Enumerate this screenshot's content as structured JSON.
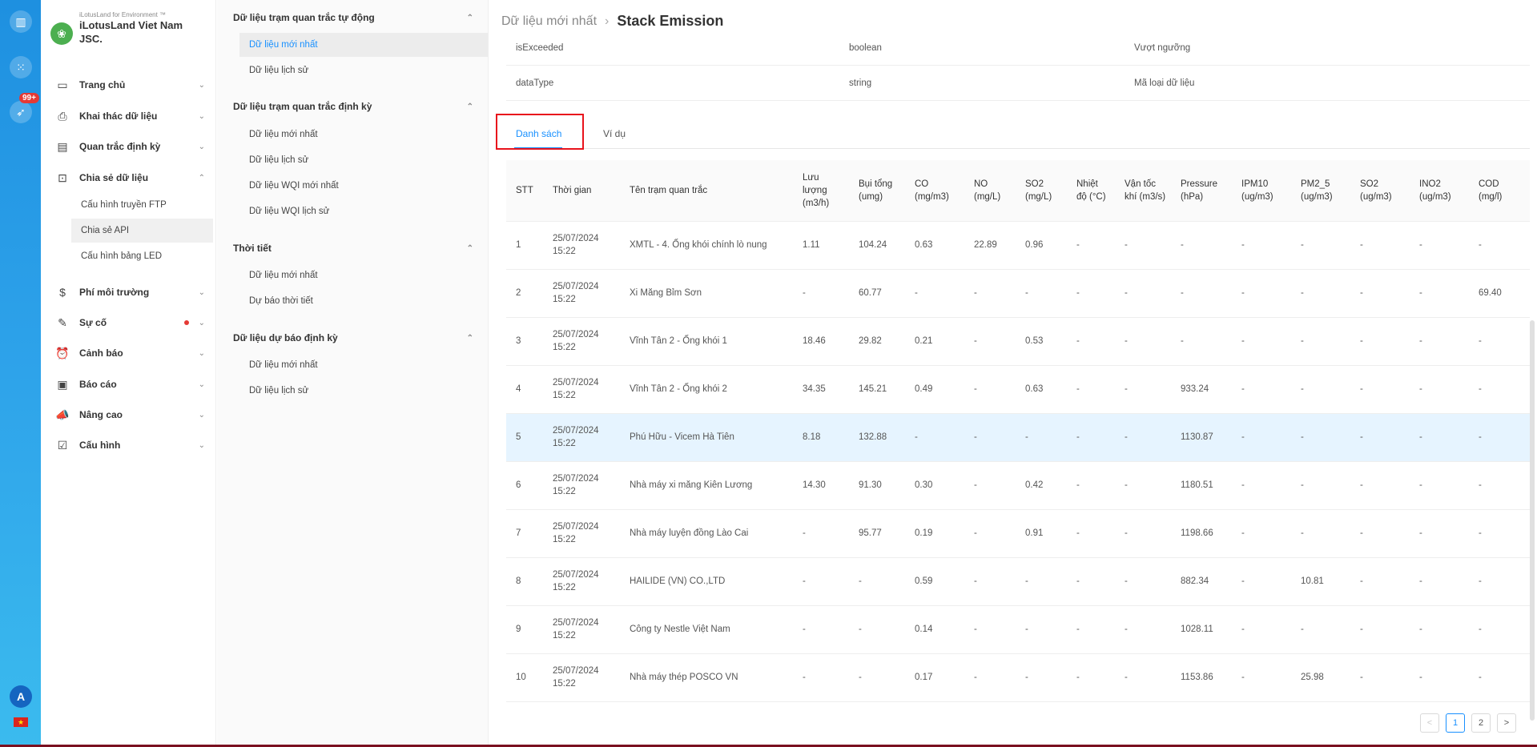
{
  "brand": {
    "sub": "iLotusLand for Environment ™",
    "name": "iLotusLand Viet Nam JSC."
  },
  "rail": {
    "badge": "99+",
    "avatar": "A",
    "flag": "★"
  },
  "nav": [
    {
      "label": "Trang chủ",
      "icon": "▭"
    },
    {
      "label": "Khai thác dữ liệu",
      "icon": "⎙"
    },
    {
      "label": "Quan trắc định kỳ",
      "icon": "▤"
    },
    {
      "label": "Chia sẻ dữ liệu",
      "icon": "⊡"
    },
    {
      "label": "Phí môi trường",
      "icon": "$"
    },
    {
      "label": "Sự cố",
      "icon": "✎"
    },
    {
      "label": "Cảnh báo",
      "icon": "⏰"
    },
    {
      "label": "Báo cáo",
      "icon": "▣"
    },
    {
      "label": "Nâng cao",
      "icon": "📣"
    },
    {
      "label": "Cấu hình",
      "icon": "☑"
    }
  ],
  "share_sub": [
    "Cấu hình truyền FTP",
    "Chia sẻ API",
    "Cấu hình bảng LED"
  ],
  "midmenu": {
    "g1": {
      "title": "Dữ liệu trạm quan trắc tự động",
      "items": [
        "Dữ liệu mới nhất",
        "Dữ liệu lịch sử"
      ]
    },
    "g2": {
      "title": "Dữ liệu trạm quan trắc định kỳ",
      "items": [
        "Dữ liệu mới nhất",
        "Dữ liệu lịch sử",
        "Dữ liệu WQI mới nhất",
        "Dữ liệu WQI lịch sử"
      ]
    },
    "g3": {
      "title": "Thời tiết",
      "items": [
        "Dữ liệu mới nhất",
        "Dự báo thời tiết"
      ]
    },
    "g4": {
      "title": "Dữ liệu dự báo định kỳ",
      "items": [
        "Dữ liệu mới nhất",
        "Dữ liệu lịch sử"
      ]
    }
  },
  "breadcrumb": {
    "parent": "Dữ liệu mới nhất",
    "current": "Stack Emission"
  },
  "fields": [
    {
      "name": "isExceeded",
      "type": "boolean",
      "desc": "Vượt ngưỡng"
    },
    {
      "name": "dataType",
      "type": "string",
      "desc": "Mã loại dữ liệu"
    }
  ],
  "tabs": {
    "list": "Danh sách",
    "example": "Ví dụ"
  },
  "table": {
    "headers": [
      "STT",
      "Thời gian",
      "Tên trạm quan trắc",
      "Lưu lượng (m3/h)",
      "Bụi tổng (umg)",
      "CO (mg/m3)",
      "NO (mg/L)",
      "SO2 (mg/L)",
      "Nhiệt độ (°C)",
      "Vận tốc khí (m3/s)",
      "Pressure (hPa)",
      "IPM10 (ug/m3)",
      "PM2_5 (ug/m3)",
      "SO2 (ug/m3)",
      "INO2 (ug/m3)",
      "COD (mg/l)"
    ],
    "rows": [
      [
        "1",
        "25/07/2024 15:22",
        "XMTL - 4. Ống khói chính lò nung",
        "1.11",
        "104.24",
        "0.63",
        "22.89",
        "0.96",
        "-",
        "-",
        "-",
        "-",
        "-",
        "-",
        "-",
        "-"
      ],
      [
        "2",
        "25/07/2024 15:22",
        "Xi Măng Bỉm Sơn",
        "-",
        "60.77",
        "-",
        "-",
        "-",
        "-",
        "-",
        "-",
        "-",
        "-",
        "-",
        "-",
        "69.40"
      ],
      [
        "3",
        "25/07/2024 15:22",
        "Vĩnh Tân 2 - Ống khói 1",
        "18.46",
        "29.82",
        "0.21",
        "-",
        "0.53",
        "-",
        "-",
        "-",
        "-",
        "-",
        "-",
        "-",
        "-"
      ],
      [
        "4",
        "25/07/2024 15:22",
        "Vĩnh Tân 2 - Ống khói 2",
        "34.35",
        "145.21",
        "0.49",
        "-",
        "0.63",
        "-",
        "-",
        "933.24",
        "-",
        "-",
        "-",
        "-",
        "-"
      ],
      [
        "5",
        "25/07/2024 15:22",
        "Phú Hữu - Vicem Hà Tiên",
        "8.18",
        "132.88",
        "-",
        "-",
        "-",
        "-",
        "-",
        "1130.87",
        "-",
        "-",
        "-",
        "-",
        "-"
      ],
      [
        "6",
        "25/07/2024 15:22",
        "Nhà máy xi măng Kiên Lương",
        "14.30",
        "91.30",
        "0.30",
        "-",
        "0.42",
        "-",
        "-",
        "1180.51",
        "-",
        "-",
        "-",
        "-",
        "-"
      ],
      [
        "7",
        "25/07/2024 15:22",
        "Nhà máy luyện đồng Lào Cai",
        "-",
        "95.77",
        "0.19",
        "-",
        "0.91",
        "-",
        "-",
        "1198.66",
        "-",
        "-",
        "-",
        "-",
        "-"
      ],
      [
        "8",
        "25/07/2024 15:22",
        "HAILIDE (VN) CO.,LTD",
        "-",
        "-",
        "0.59",
        "-",
        "-",
        "-",
        "-",
        "882.34",
        "-",
        "10.81",
        "-",
        "-",
        "-"
      ],
      [
        "9",
        "25/07/2024 15:22",
        "Công ty Nestle Việt Nam",
        "-",
        "-",
        "0.14",
        "-",
        "-",
        "-",
        "-",
        "1028.11",
        "-",
        "-",
        "-",
        "-",
        "-"
      ],
      [
        "10",
        "25/07/2024 15:22",
        "Nhà máy thép POSCO VN",
        "-",
        "-",
        "0.17",
        "-",
        "-",
        "-",
        "-",
        "1153.86",
        "-",
        "25.98",
        "-",
        "-",
        "-"
      ]
    ],
    "warn_cells": [
      [
        0,
        6
      ],
      [
        1,
        15
      ],
      [
        2,
        5
      ]
    ],
    "highlight_row": 4,
    "warn_color": "#faad14"
  },
  "pager": {
    "prev": "<",
    "pages": [
      "1",
      "2"
    ],
    "next": ">",
    "current": "1"
  },
  "colors": {
    "accent": "#1890ff",
    "highlight_border": "#e8131c",
    "rail": "#2ea3ea"
  }
}
